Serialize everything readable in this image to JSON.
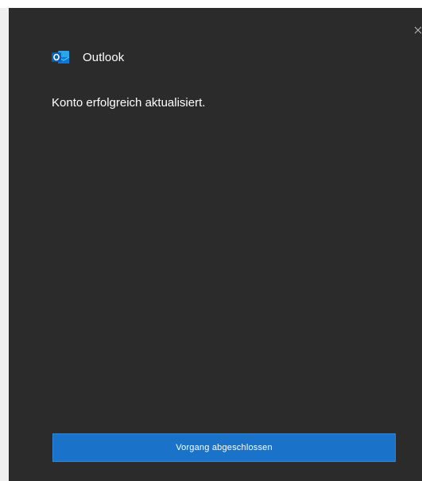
{
  "header": {
    "app_name": "Outlook",
    "logo_icon": "outlook-logo-icon"
  },
  "main": {
    "message": "Konto erfolgreich aktualisiert."
  },
  "footer": {
    "primary_button_label": "Vorgang abgeschlossen"
  },
  "window": {
    "close_icon": "close-icon"
  },
  "colors": {
    "background": "#2b2b2b",
    "accent": "#1a73c8",
    "text": "#ffffff"
  }
}
